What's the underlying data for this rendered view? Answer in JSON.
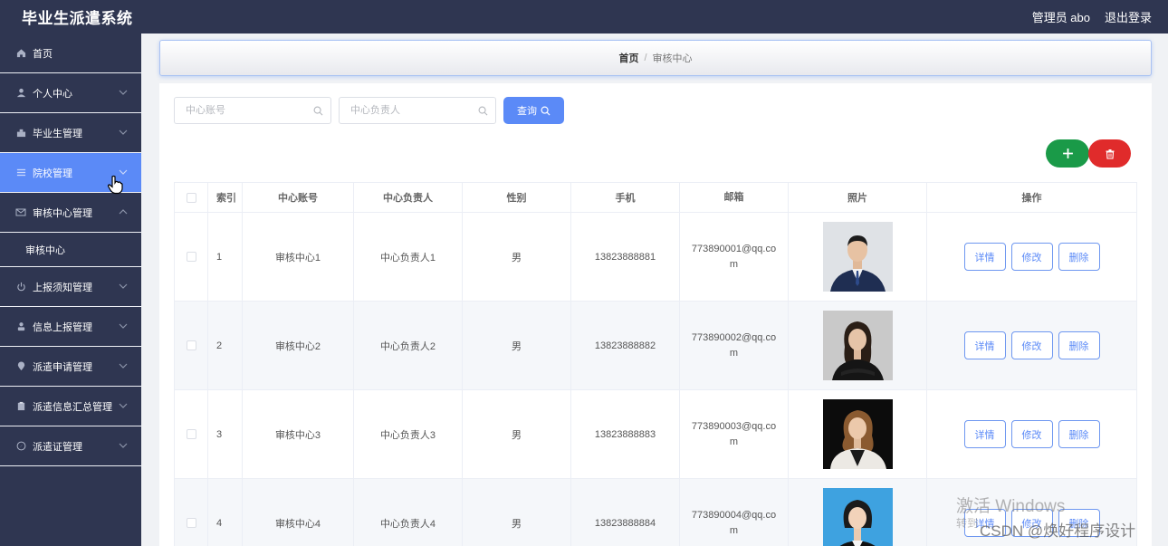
{
  "app": {
    "title": "毕业生派遣系统",
    "user": "管理员 abo",
    "logout": "退出登录"
  },
  "sidebar": {
    "items": [
      {
        "label": "首页",
        "icon": "home-icon"
      },
      {
        "label": "个人中心",
        "icon": "user-icon"
      },
      {
        "label": "毕业生管理",
        "icon": "graduate-icon"
      },
      {
        "label": "院校管理",
        "icon": "list-icon"
      },
      {
        "label": "审核中心管理",
        "icon": "mail-icon"
      },
      {
        "label": "上报须知管理",
        "icon": "power-icon"
      },
      {
        "label": "信息上报管理",
        "icon": "person-icon"
      },
      {
        "label": "派遣申请管理",
        "icon": "location-icon"
      },
      {
        "label": "派遣信息汇总管理",
        "icon": "clipboard-icon"
      },
      {
        "label": "派遣证管理",
        "icon": "compass-icon"
      }
    ],
    "sub_item": "审核中心"
  },
  "breadcrumb": {
    "home": "首页",
    "sep": "/",
    "current": "审核中心"
  },
  "search": {
    "account_placeholder": "中心账号",
    "manager_placeholder": "中心负责人",
    "query_label": "查询"
  },
  "table": {
    "headers": [
      "索引",
      "中心账号",
      "中心负责人",
      "性别",
      "手机",
      "邮箱",
      "照片",
      "操作"
    ],
    "rows": [
      {
        "index": "1",
        "account": "审核中心1",
        "manager": "中心负责人1",
        "gender": "男",
        "phone": "13823888881",
        "email": "773890001@qq.com"
      },
      {
        "index": "2",
        "account": "审核中心2",
        "manager": "中心负责人2",
        "gender": "男",
        "phone": "13823888882",
        "email": "773890002@qq.com"
      },
      {
        "index": "3",
        "account": "审核中心3",
        "manager": "中心负责人3",
        "gender": "男",
        "phone": "13823888883",
        "email": "773890003@qq.com"
      },
      {
        "index": "4",
        "account": "审核中心4",
        "manager": "中心负责人4",
        "gender": "男",
        "phone": "13823888884",
        "email": "773890004@qq.com"
      }
    ],
    "actions": {
      "detail": "详情",
      "edit": "修改",
      "delete": "删除"
    }
  },
  "watermark": {
    "activate": "激活 Windows",
    "goto": "转到",
    "csdn": "CSDN @焕好程序设计"
  },
  "colors": {
    "sidebar_bg": "#2f3651",
    "accent": "#5b8af7",
    "add": "#1a9a48",
    "delete": "#e02b2b"
  }
}
